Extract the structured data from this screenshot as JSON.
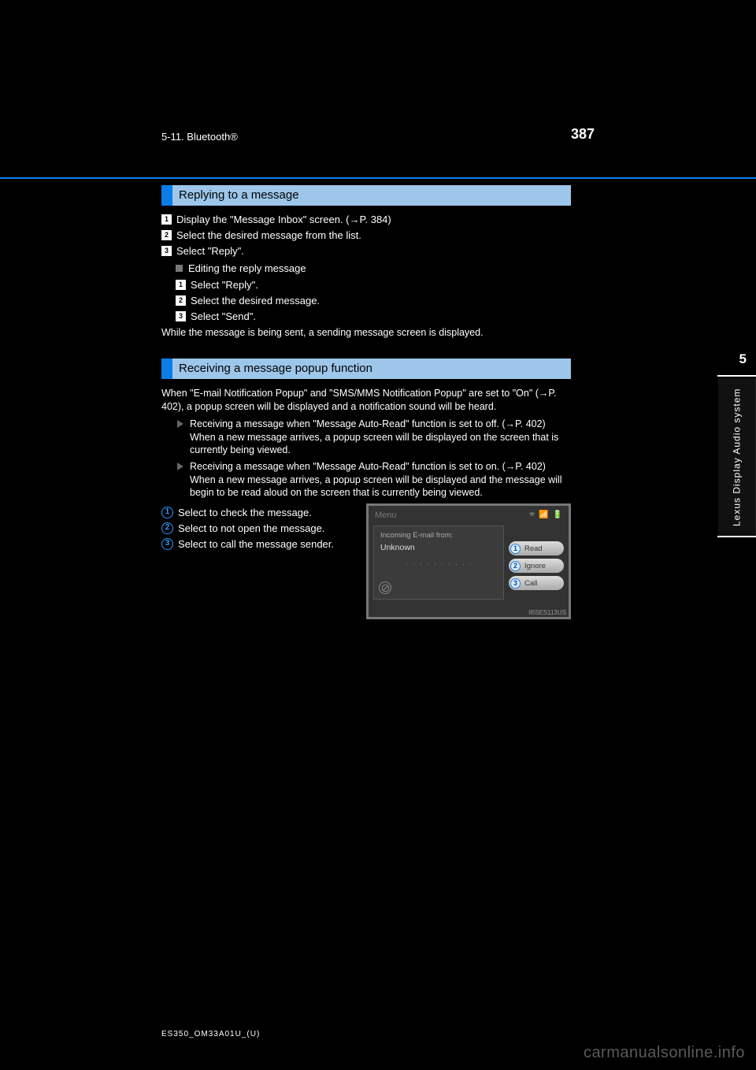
{
  "page": {
    "number": "387",
    "section_header": "5-11. Bluetooth®",
    "doc_filename": "ES350_OM33A01U_(U)",
    "watermark": "carmanualsonline.info"
  },
  "side_tab": {
    "chapter": "5",
    "label": "Lexus Display Audio system"
  },
  "section1": {
    "title": "Replying to a message",
    "step1": "Display the \"Message Inbox\" screen. (→P. 384)",
    "step2": "Select the desired message from the list.",
    "step3": "Select \"Reply\".",
    "sub_title": "Editing the reply message",
    "sub_step1": "Select \"Reply\".",
    "sub_step2": "Select the desired message.",
    "sub_step3": "Select \"Send\".",
    "sub_note": "While the message is being sent, a sending message screen is displayed."
  },
  "section2": {
    "title": "Receiving a message popup function",
    "intro": "When \"E-mail Notification Popup\" and \"SMS/MMS Notification Popup\" are set to \"On\" (→P. 402), a popup screen will be displayed and a notification sound will be heard.",
    "bullet1_head": "Receiving a message when \"Message Auto-Read\" function is set to off. (→P. 402)",
    "bullet1_body": "When a new message arrives, a popup screen will be displayed on the screen that is currently being viewed.",
    "bullet2_head": "Receiving a message when \"Message Auto-Read\" function is set to on. (→P. 402)",
    "bullet2_body": "When a new message arrives, a popup screen will be displayed and the message will begin to be read aloud on the screen that is currently being viewed.",
    "c1": "Select to check the message.",
    "c2": "Select to not open the message.",
    "c3": "Select to call the message sender."
  },
  "figure": {
    "title": "Menu",
    "incoming_label": "Incoming E-mail from:",
    "sender": "Unknown",
    "dots": ". . . . . . . . . .",
    "btn1": "Read",
    "btn2": "Ignore",
    "btn3": "Call",
    "code": "II55ES113US"
  }
}
